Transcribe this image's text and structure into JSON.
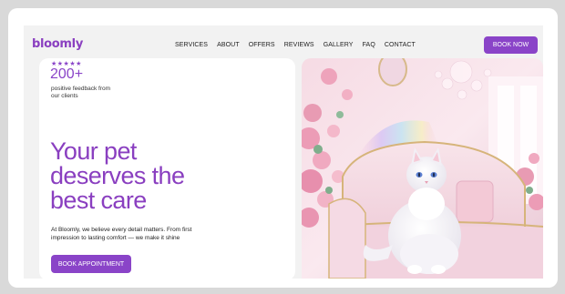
{
  "brand": {
    "logo": "bloomly",
    "accent": "#8a44c8"
  },
  "nav": {
    "items": [
      "SERVICES",
      "ABOUT",
      "OFFERS",
      "REVIEWS",
      "GALLERY",
      "FAQ",
      "CONTACT"
    ],
    "cta_label": "BOOK NOW"
  },
  "hero": {
    "rating_stars": "★★★★★",
    "stat_value": "200+",
    "stat_caption": "positive feedback from our clients",
    "headline": "Your pet deserves the best care",
    "description": "At Bloomly, we believe every detail matters. From first impression to lasting comfort — we make it shine",
    "cta_label": "BOOK APPOINTMENT",
    "image_subject": "white fluffy cat on a pink sofa among roses"
  }
}
